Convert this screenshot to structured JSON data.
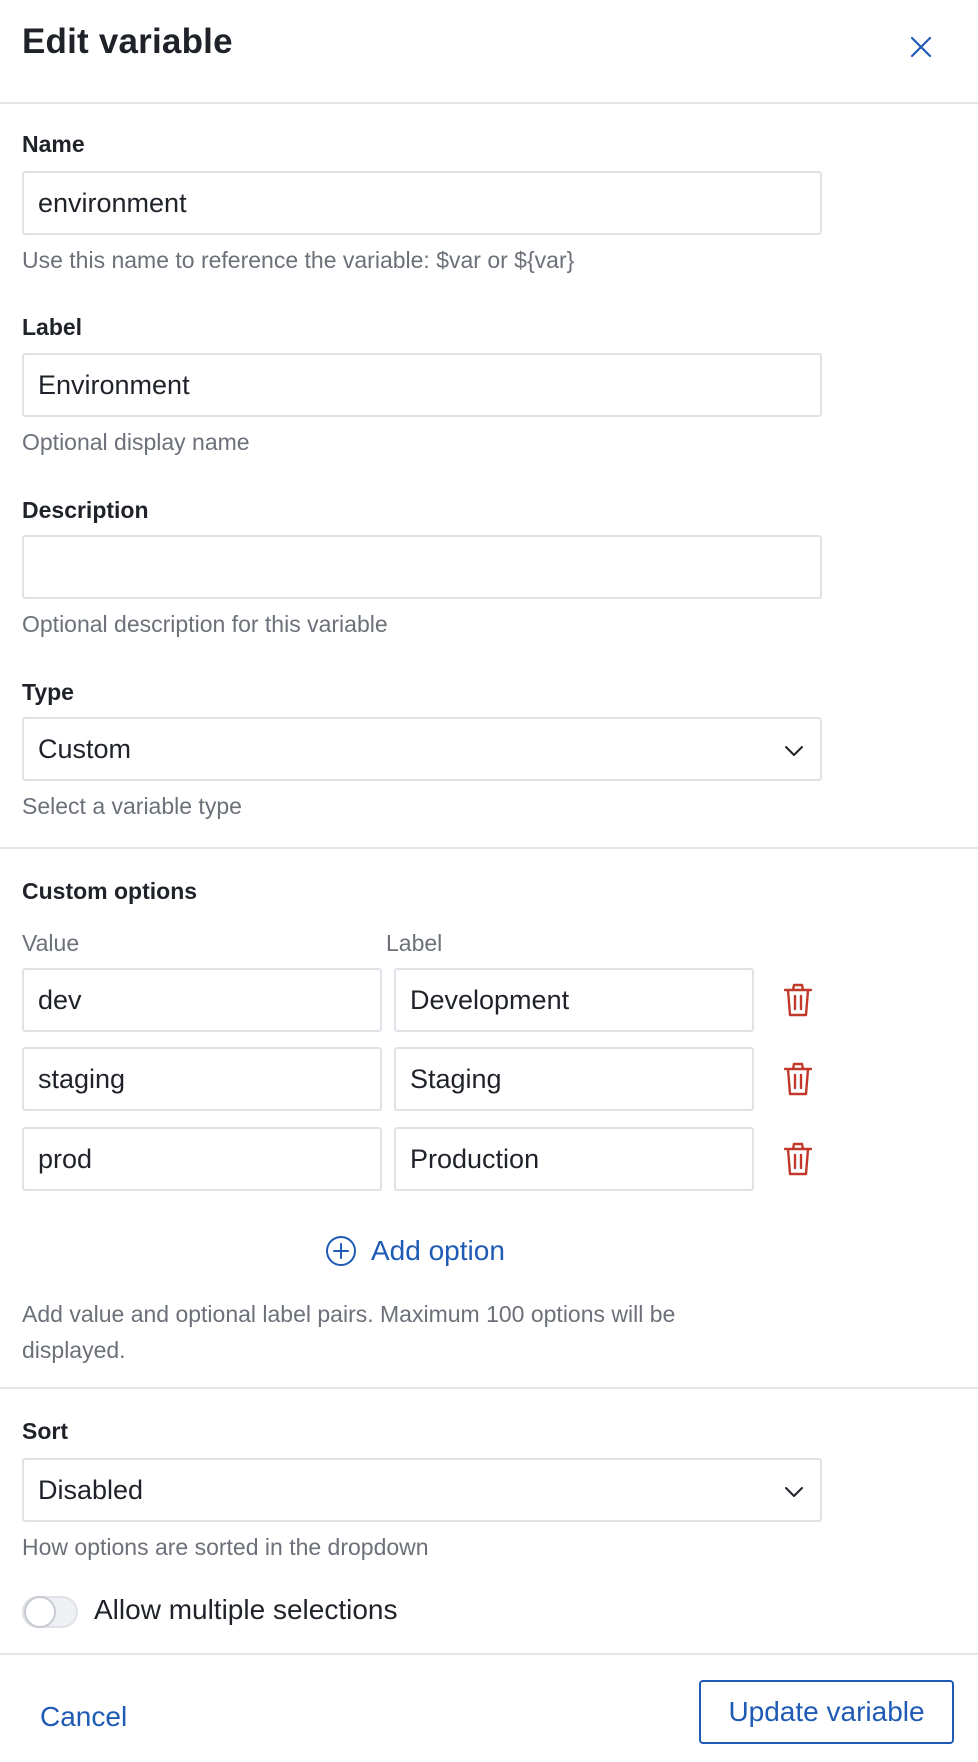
{
  "header": {
    "title": "Edit variable",
    "close_icon": "close-icon"
  },
  "name": {
    "label": "Name",
    "value": "environment",
    "helper": "Use this name to reference the variable: $var or ${var}"
  },
  "label_field": {
    "label": "Label",
    "value": "Environment",
    "helper": "Optional display name"
  },
  "description": {
    "label": "Description",
    "value": "",
    "helper": "Optional description for this variable"
  },
  "type": {
    "label": "Type",
    "selected": "Custom",
    "helper": "Select a variable type"
  },
  "custom_options": {
    "heading": "Custom options",
    "value_header": "Value",
    "label_header": "Label",
    "rows": [
      {
        "value": "dev",
        "label": "Development"
      },
      {
        "value": "staging",
        "label": "Staging"
      },
      {
        "value": "prod",
        "label": "Production"
      }
    ],
    "add_label": "Add option",
    "helper": "Add value and optional label pairs. Maximum 100 options will be displayed.",
    "delete_color": "#c0392b"
  },
  "sort": {
    "label": "Sort",
    "selected": "Disabled",
    "helper": "How options are sorted in the dropdown"
  },
  "multi": {
    "label": "Allow multiple selections",
    "enabled": false
  },
  "footer": {
    "cancel_label": "Cancel",
    "update_label": "Update variable"
  },
  "colors": {
    "accent": "#1f5bb5",
    "border": "#dfe2e6",
    "muted_text": "#6b7079"
  }
}
